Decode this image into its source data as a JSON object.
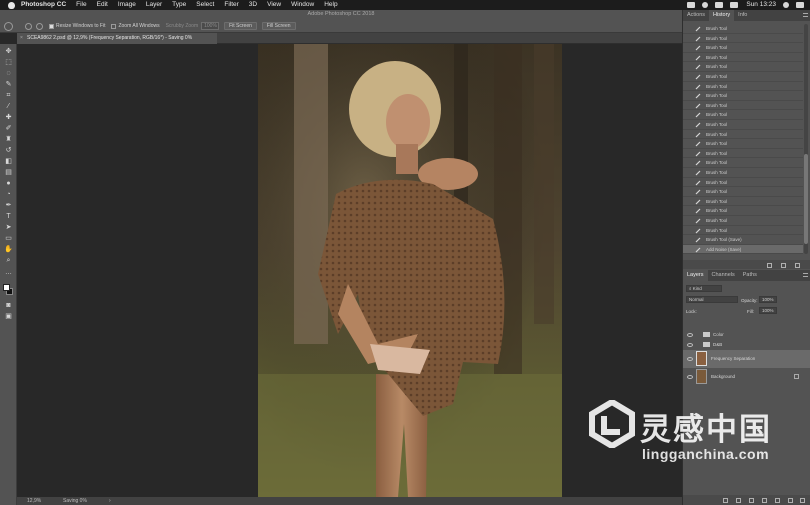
{
  "menubar": {
    "app_name": "Photoshop CC",
    "items": [
      "File",
      "Edit",
      "Image",
      "Layer",
      "Type",
      "Select",
      "Filter",
      "3D",
      "View",
      "Window",
      "Help"
    ],
    "clock": "Sun 13:23"
  },
  "window": {
    "title": "Adobe Photoshop CC 2018"
  },
  "options_bar": {
    "resize_windows_label": "Resize Windows to Fit",
    "zoom_all_label": "Zoom All Windows",
    "scrubby_label": "Scrubby Zoom",
    "zoom_value": "100%",
    "fit_screen_label": "Fit Screen",
    "fill_screen_label": "Fill Screen"
  },
  "document": {
    "tab_title": "SCEA9862 2.psd @ 12,9% (Frequency Separation, RGB/16*) - Saving 0%"
  },
  "status": {
    "zoom": "12,9%",
    "saving": "Saving 0%"
  },
  "history_panel": {
    "tabs": [
      "Actions",
      "History",
      "Info"
    ],
    "active_tab": "History",
    "entries": [
      "Brush Tool",
      "Brush Tool",
      "Brush Tool",
      "Brush Tool",
      "Brush Tool",
      "Brush Tool",
      "Brush Tool",
      "Brush Tool",
      "Brush Tool",
      "Brush Tool",
      "Brush Tool",
      "Brush Tool",
      "Brush Tool",
      "Brush Tool",
      "Brush Tool",
      "Brush Tool",
      "Brush Tool",
      "Brush Tool",
      "Brush Tool",
      "Brush Tool",
      "Brush Tool",
      "Brush Tool"
    ],
    "last_entry": "Brush Tool (Save)",
    "current_entry": "Add Noise (Save)"
  },
  "layers_panel": {
    "tabs": [
      "Layers",
      "Channels",
      "Paths"
    ],
    "active_tab": "Layers",
    "kind_label": "Kind",
    "blend_mode": "Normal",
    "opacity_label": "Opacity:",
    "opacity_value": "100%",
    "lock_label": "Lock:",
    "fill_label": "Fill:",
    "fill_value": "100%",
    "layers": [
      {
        "name": "Color",
        "type": "group"
      },
      {
        "name": "D&B",
        "type": "group"
      },
      {
        "name": "Frequency Separation",
        "type": "layer"
      },
      {
        "name": "Background",
        "type": "layer"
      }
    ]
  },
  "watermark": {
    "chinese": "灵感中国",
    "url": "lingganchina.com"
  },
  "colors": {
    "panel_bg": "#535353",
    "canvas_bg": "#282828",
    "selection": "#6a6a6a",
    "menubar": "#1c1c1c"
  }
}
